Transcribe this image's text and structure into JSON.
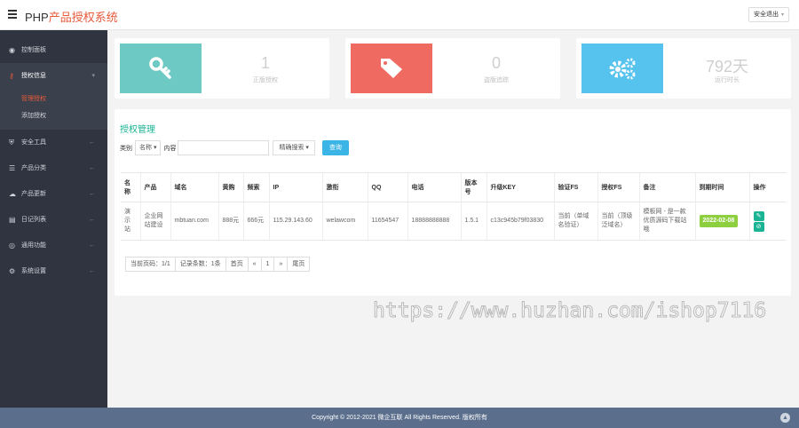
{
  "header": {
    "brand_prefix": "PHP",
    "brand_suffix": "产品授权系统",
    "logout_label": "安全退出",
    "logout_caret": "▾"
  },
  "sidebar": {
    "items": [
      {
        "icon": "dashboard-icon",
        "label": "控制面板",
        "arrow": ""
      },
      {
        "icon": "key-icon",
        "label": "授权信息",
        "arrow": "▾",
        "active": true
      },
      {
        "icon": "shield-icon",
        "label": "安全工具",
        "arrow": "←"
      },
      {
        "icon": "list-icon",
        "label": "产品分类",
        "arrow": "←"
      },
      {
        "icon": "cloud-icon",
        "label": "产品更新",
        "arrow": "←"
      },
      {
        "icon": "calendar-icon",
        "label": "日记列表",
        "arrow": "←"
      },
      {
        "icon": "globe-icon",
        "label": "通用功能",
        "arrow": "←"
      },
      {
        "icon": "gears-icon",
        "label": "系统设置",
        "arrow": "←"
      }
    ],
    "submenu": [
      {
        "label": "管理授权",
        "current": true
      },
      {
        "label": "添加授权",
        "current": false
      }
    ]
  },
  "stats": [
    {
      "icon": "key-icon",
      "value": "1",
      "label": "正版授权",
      "color": "#6dc9c4"
    },
    {
      "icon": "tag-icon",
      "value": "0",
      "label": "盗版追踪",
      "color": "#ef6a61"
    },
    {
      "icon": "gears-icon",
      "value": "792天",
      "label": "运行时长",
      "color": "#56c2ee"
    }
  ],
  "panel": {
    "title": "授权管理",
    "search": {
      "category_label": "类别",
      "category_value": "名称",
      "content_label": "内容",
      "mode_value": "精确搜索",
      "button": "查询"
    }
  },
  "table": {
    "headers": [
      "名称",
      "产品",
      "域名",
      "黄购",
      "频索",
      "IP",
      "激衔",
      "QQ",
      "电话",
      "版本号",
      "升级KEY",
      "验证FS",
      "授权FS",
      "备注",
      "到期时间",
      "操作"
    ],
    "rows": [
      [
        "演示站",
        "企业网站建设",
        "mbtuan.com",
        "888元",
        "666元",
        "115.29.143.60",
        "welawcom",
        "11654547",
        "18888888888",
        "1.5.1",
        "c13c945b79f03830",
        "当前（单域名验证）",
        "当前（顶级泛域名）",
        "模板网 - 是一款优质源码下载站哦",
        "2022-02-08",
        ""
      ]
    ]
  },
  "pager": {
    "current": "当前页码：1/1",
    "records": "记录条数：1条",
    "first": "首页",
    "prev": "«",
    "page": "1",
    "next": "»",
    "last": "尾页"
  },
  "watermark": "https://www.huzhan.com/ishop7116",
  "footer": {
    "text": "Copyright © 2012-2021 微企互联 All Rights Reserved. 版权所有",
    "totop": "▲"
  },
  "colors": {
    "accent": "#1ab394",
    "brand": "#e75a3a",
    "sidebar": "#2f3440",
    "footer": "#5b6f8d",
    "badge": "#8dcf3f",
    "search_button": "#3ab5e6"
  }
}
